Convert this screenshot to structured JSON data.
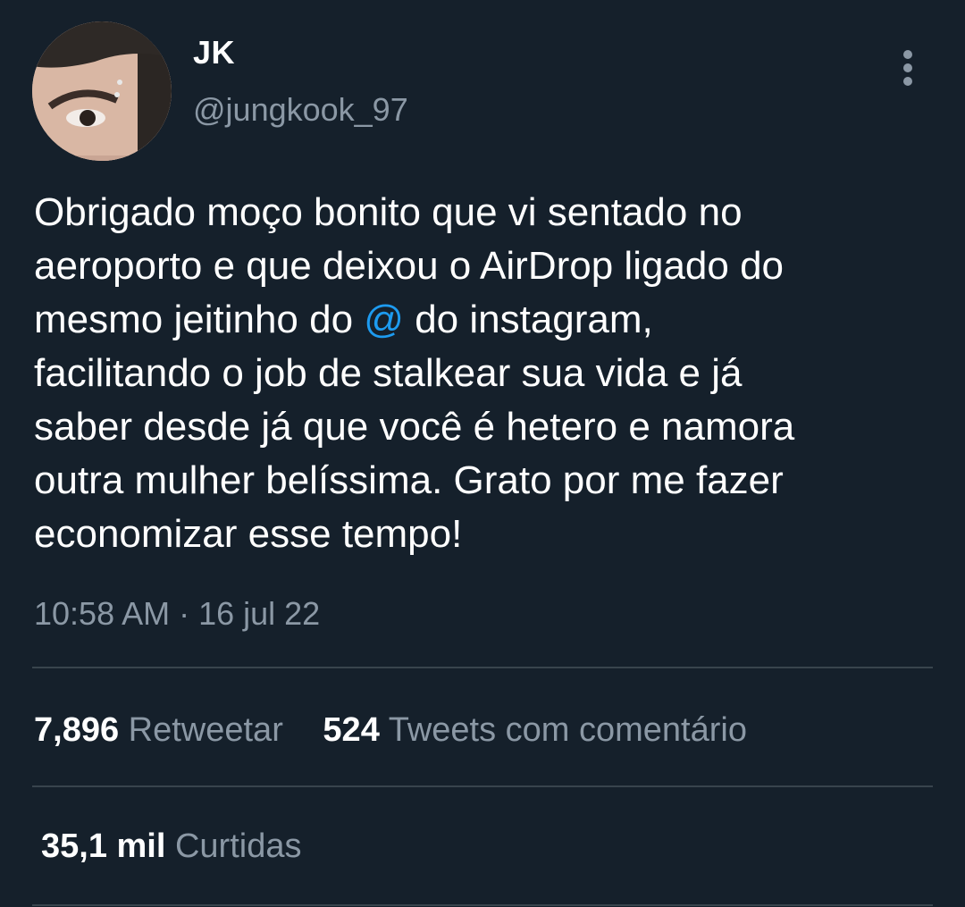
{
  "colors": {
    "background": "#15202b",
    "text_primary": "#ffffff",
    "text_secondary": "#8b98a5",
    "mention": "#1d9bf0",
    "divider": "#38444d"
  },
  "author": {
    "display_name": "JK",
    "handle": "@jungkook_97",
    "avatar_icon": "profile-photo"
  },
  "more_icon": "vertical-ellipsis-icon",
  "tweet": {
    "lines": [
      "Obrigado moço bonito que vi sentado no",
      "aeroporto e que deixou o AirDrop ligado do",
      {
        "before": "mesmo jeitinho do ",
        "mention": "@",
        "after": " do instagram,"
      },
      "facilitando o job de stalkear sua vida e já",
      "saber desde já que você é hetero e namora",
      "outra mulher belíssima. Grato por me fazer",
      "economizar esse tempo!"
    ],
    "timestamp": "10:58 AM · 16 jul 22"
  },
  "stats": {
    "retweets_count": "7,896",
    "retweets_label": "Retweetar",
    "quotes_count": "524",
    "quotes_label": "Tweets com comentário",
    "likes_count": "35,1 mil",
    "likes_label": "Curtidas"
  }
}
